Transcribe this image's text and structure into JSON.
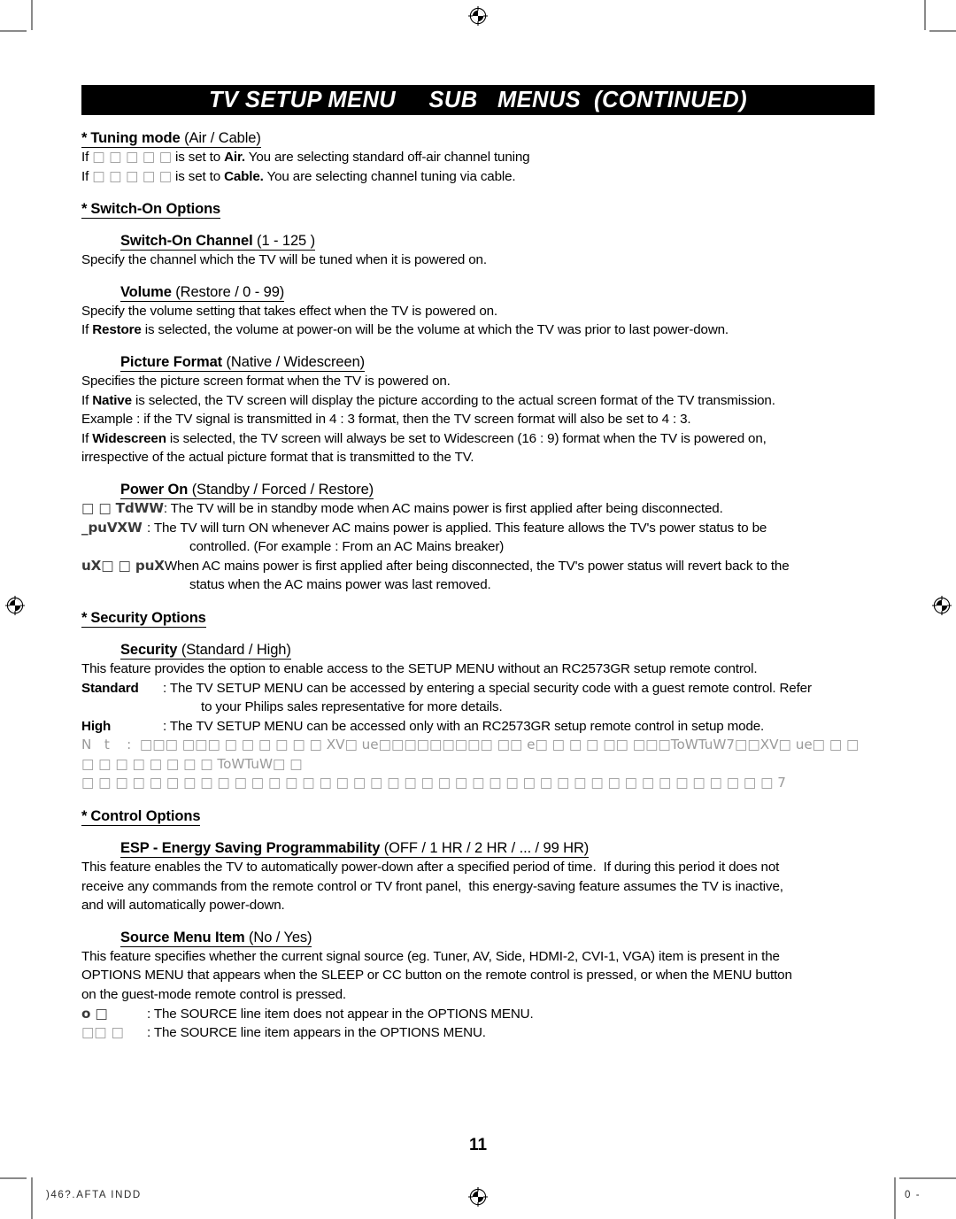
{
  "banner": {
    "title": "TV SETUP MENU     SUB   MENUS  (CONTINUED)"
  },
  "sections": {
    "tuning_mode": {
      "heading_star": "*",
      "heading_bold": "Tuning mode",
      "heading_reg": "(Air / Cable)",
      "line1_pre": "If ",
      "line1_garble": "□ □ □ □ □",
      "line1_mid": " is set to ",
      "line1_bold": "Air.",
      "line1_post": " You are selecting standard off-air channel tuning",
      "line2_pre": "If ",
      "line2_garble": "□ □ □ □ □",
      "line2_mid": " is set to ",
      "line2_bold": "Cable.",
      "line2_post": " You are selecting channel tuning via cable."
    },
    "switch_on_options": {
      "heading_star": "*",
      "heading_bold": "Switch-On Options",
      "switch_on_channel": {
        "heading_bold": "Switch-On Channel",
        "heading_reg": "(1 - 125 )",
        "line1": "Specify the channel which the TV will be tuned when it is powered on."
      },
      "volume": {
        "heading_bold": "Volume",
        "heading_reg": "(Restore / 0 - 99)",
        "line1": "Specify the volume setting that takes effect when the TV is powered on.",
        "line2_pre": "If ",
        "line2_bold": "Restore",
        "line2_post": " is selected, the volume at power-on will be the volume at which the TV was prior to last power-down."
      },
      "picture_format": {
        "heading_bold": "Picture Format",
        "heading_reg": "(Native / Widescreen)",
        "line1": "Specifies the picture screen format when the TV is powered on.",
        "line2_pre": "If ",
        "line2_bold": "Native",
        "line2_post": " is selected, the TV screen will display the picture according to the actual screen format of the TV transmission.",
        "line3": "Example : if the TV signal is transmitted in 4 : 3 format, then the TV screen format will also be set to 4 : 3.",
        "line4_pre": "If ",
        "line4_bold": "Widescreen",
        "line4_post": " is selected, the TV screen will always be set to Widescreen (16 : 9) format when the TV is powered on,",
        "line5": "irrespective of the actual picture format that is transmitted to the TV."
      },
      "power_on": {
        "heading_bold": "Power On",
        "heading_reg": "(Standby / Forced / Restore)",
        "rows": [
          {
            "label": "□ □ TdWW",
            "text": ": The TV will be in standby mode when AC mains power is first applied after being disconnected.",
            "cont": ""
          },
          {
            "label": "_puVXW",
            "text": ": The TV will turn ON whenever AC mains power is applied.  This feature allows the TV's power status to be",
            "cont": "controlled. (For example : From an AC Mains breaker)"
          },
          {
            "label": "uX□ □ puX",
            "text": "When AC mains power is first applied after being disconnected, the TV's power status will revert back to the",
            "cont": "status when the AC mains power was last removed."
          }
        ]
      }
    },
    "security_options": {
      "heading_star": "*",
      "heading_bold": "Security Options",
      "security": {
        "heading_bold": "Security",
        "heading_reg": "(Standard / High)",
        "line1": "This feature provides the option to enable access to the SETUP MENU without an RC2573GR setup remote control.",
        "rows": [
          {
            "label": "Standard",
            "text": ": The TV SETUP MENU can be accessed by entering a special security code with a guest remote control. Refer",
            "cont": "to your Philips sales representative for more details."
          },
          {
            "label": "High",
            "text": ": The TV SETUP MENU can be accessed only with an RC2573GR setup remote control in setup mode.",
            "cont": ""
          }
        ],
        "note_line1": "N   t    :  □□□ □□□ □ □ □ □ □ □ XV□ ue□□□□□□□□□ □□ e□ □ □ □ □□ □□□ToWTuW7□□XV□ ue□ □ □ □ □ □ □ □ □ □ □ ToWTuW□ □",
        "note_line2": "□ □ □ □ □ □ □ □ □ □ □ □ □ □ □ □ □ □ □ □ □ □ □ □ □ □ □ □ □ □ □ □ □ □ □ □ □ □ □ □ □ 7"
      }
    },
    "control_options": {
      "heading_star": "*",
      "heading_bold": "Control Options",
      "esp": {
        "heading_bold": "ESP - Energy Saving Programmability",
        "heading_reg": "(OFF / 1 HR / 2 HR / ... / 99 HR)",
        "line1": "This feature enables the TV to automatically power-down after a specified period of time.  If during this period it does not",
        "line2": "receive any commands from the remote control or TV front panel,  this energy-saving feature assumes the TV is inactive,",
        "line3": "and will automatically power-down."
      },
      "source_menu_item": {
        "heading_bold": "Source Menu Item",
        "heading_reg": "(No / Yes)",
        "line1": "This feature specifies whether the current signal source (eg. Tuner, AV, Side, HDMI-2, CVI-1, VGA) item is present in the",
        "line2": "OPTIONS MENU that appears when the SLEEP or CC button on the remote control is pressed, or when the MENU button",
        "line3": "on the guest-mode remote control is pressed.",
        "rows": [
          {
            "label": "o □",
            "text": ": The SOURCE line item does not appear in the OPTIONS MENU."
          },
          {
            "label": "□□ □",
            "text": ": The SOURCE line item appears in the OPTIONS MENU."
          }
        ]
      }
    }
  },
  "page_number": "11",
  "footer": {
    "left_slug": ")46?.AFTA INDD",
    "right_slug": "0 -"
  }
}
